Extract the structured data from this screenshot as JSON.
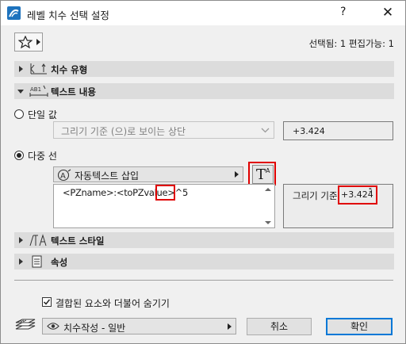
{
  "window": {
    "title": "레벨 치수 선택 설정",
    "help": "?",
    "close": "✕"
  },
  "header": {
    "selection_info": "선택됨: 1 편집가능: 1"
  },
  "sections": {
    "dimension_type": {
      "label": "치수 유형"
    },
    "text_content": {
      "label": "텍스트 내용",
      "ico_text": "AB1"
    },
    "text_style": {
      "label": "텍스트 스타일"
    },
    "properties": {
      "label": "속성"
    }
  },
  "single_value": {
    "label": "단일 값",
    "combo_value": "그리기 기준 (으)로 보이는 상단",
    "value": "+3.424"
  },
  "multi_line": {
    "label": "다중 선",
    "autotext_label": "자동텍스트 삽입",
    "text_style_button": {
      "T": "T",
      "A": "A"
    },
    "text_value_part1": "<PZname>:<toPZvalue>",
    "text_value_part2": "^5",
    "preview_label": "그리기 기준",
    "preview_value": "+3.424",
    "preview_superscript": "5"
  },
  "footer": {
    "hide_checkbox_label": "결합된 요소와 더불어 숨기기",
    "hide_checked": true,
    "layer_value": "치수작성 - 일반",
    "cancel_label": "취소",
    "ok_label": "확인"
  },
  "colors": {
    "highlight": "#e00000",
    "section_bg": "#dcdcdc",
    "accent": "#0078d7"
  }
}
